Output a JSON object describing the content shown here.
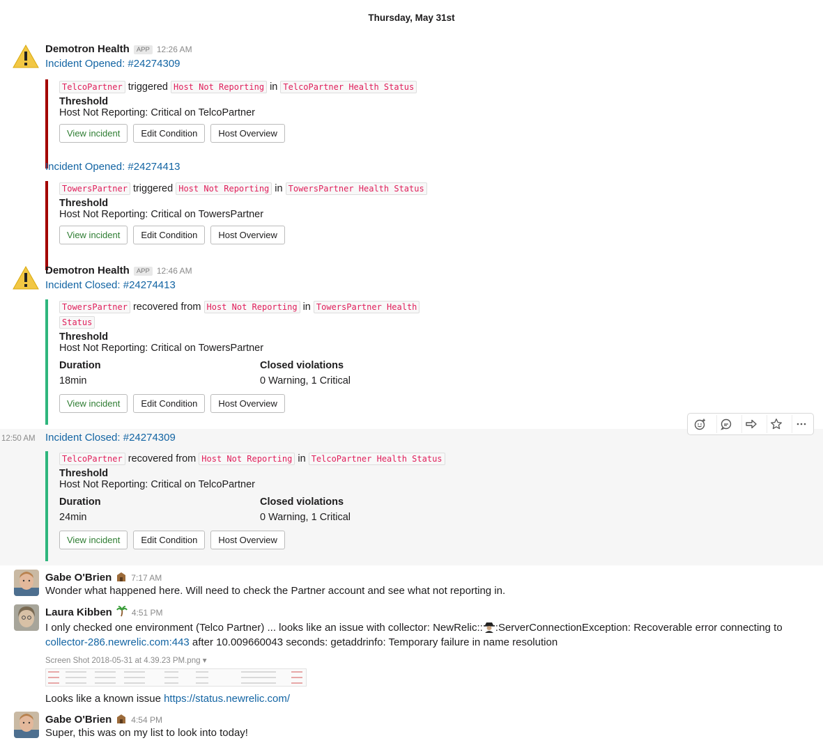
{
  "day_divider": "Thursday, May 31st",
  "common": {
    "app_badge": "APP",
    "word_triggered": "triggered",
    "word_recovered": "recovered from",
    "word_in": "in",
    "threshold_title": "Threshold",
    "duration_title": "Duration",
    "closed_violations_title": "Closed violations",
    "btn_view": "View incident",
    "btn_edit": "Edit Condition",
    "btn_host": "Host Overview"
  },
  "bot": {
    "name": "Demotron Health"
  },
  "incidents": [
    {
      "time": "12:26 AM",
      "title": "Incident Opened: #24274309",
      "entity": "TelcoPartner",
      "condition": "Host Not Reporting",
      "policy": "TelcoPartner Health Status",
      "threshold": "Host Not Reporting: Critical on TelcoPartner"
    },
    {
      "title": "Incident Opened: #24274413",
      "entity": "TowersPartner",
      "condition": "Host Not Reporting",
      "policy": "TowersPartner Health Status",
      "threshold": "Host Not Reporting: Critical on TowersPartner"
    },
    {
      "time": "12:46 AM",
      "title": "Incident Closed: #24274413",
      "entity": "TowersPartner",
      "condition": "Host Not Reporting",
      "policy_part1": "TowersPartner Health",
      "policy_part2": "Status",
      "threshold": "Host Not Reporting: Critical on TowersPartner",
      "duration": "18min",
      "violations": "0 Warning, 1 Critical"
    },
    {
      "time": "12:50 AM",
      "title": "Incident Closed: #24274309",
      "entity": "TelcoPartner",
      "condition": "Host Not Reporting",
      "policy": "TelcoPartner Health Status",
      "threshold": "Host Not Reporting: Critical on TelcoPartner",
      "duration": "24min",
      "violations": "0 Warning, 1 Critical"
    }
  ],
  "messages": [
    {
      "user": "Gabe O'Brien",
      "time": "7:17 AM",
      "text": "Wonder what happened here.  Will need to check the Partner account and see what not reporting in."
    },
    {
      "user": "Laura Kibben",
      "time": "4:51 PM",
      "text_line1a": "I only checked one environment (Telco Partner) ... looks like an issue with collector:  NewRelic::",
      "text_line1b": ":ServerConnectionException: Recoverable error connecting to",
      "link": "collector-286.newrelic.com:443",
      "text_line2": " after 10.009660043 seconds: getaddrinfo: Temporary failure in name resolution",
      "file_name": "Screen Shot 2018-05-31 at 4.39.23 PM.png",
      "file_caret": "▾",
      "followup": "Looks like a known issue ",
      "followup_link": "https://status.newrelic.com/"
    },
    {
      "user": "Gabe O'Brien",
      "time": "4:54 PM",
      "text": "Super, this was on my list to look into today!"
    }
  ],
  "icons": {
    "warning": "warning-icon",
    "emoji": "add-reaction-icon",
    "thread": "reply-thread-icon",
    "share": "share-icon",
    "star": "star-icon",
    "more": "more-actions-icon"
  },
  "colors": {
    "link": "#1264a3",
    "opened_border": "#a30200",
    "closed_border": "#2eb67d",
    "code_text": "#e01e5a",
    "view_button_text": "#2e7d32"
  }
}
